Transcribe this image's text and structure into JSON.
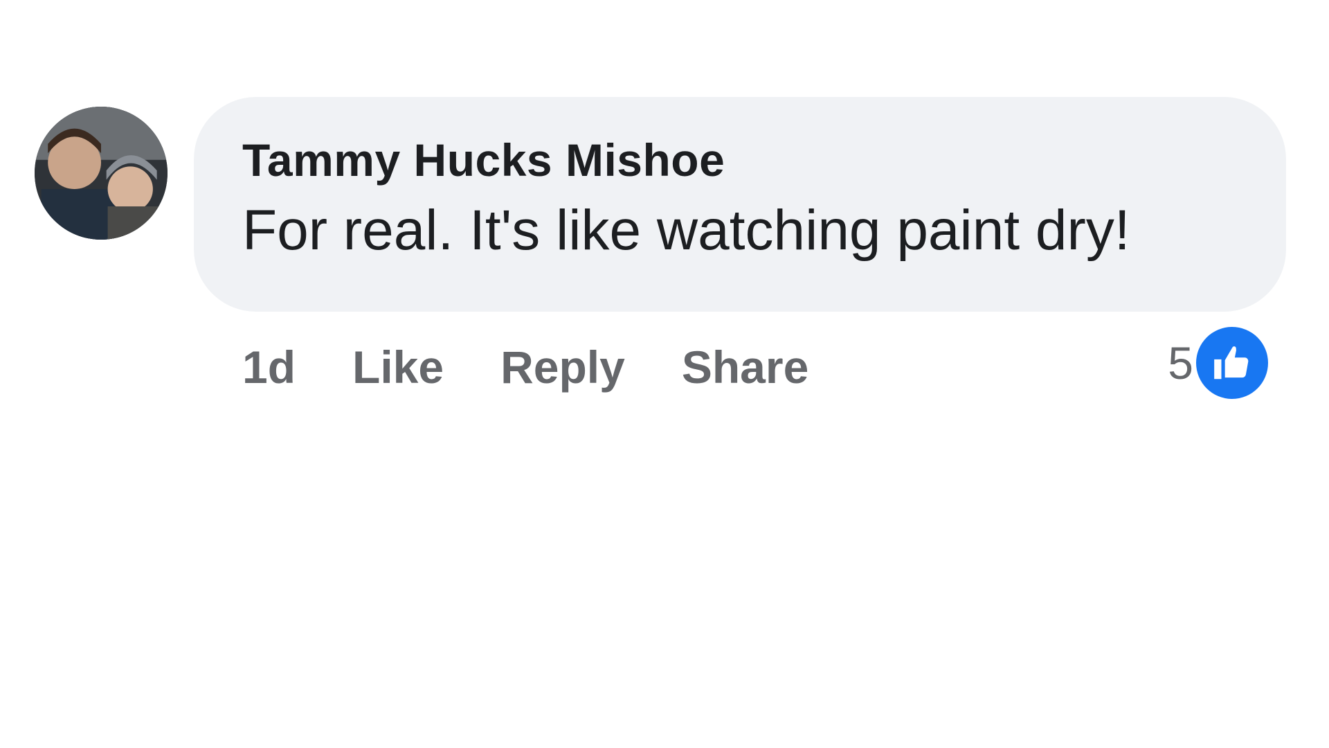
{
  "comment": {
    "author": "Tammy Hucks Mishoe",
    "text": "For real. It's like watching paint dry!",
    "timestamp": "1d",
    "actions": {
      "like_label": "Like",
      "reply_label": "Reply",
      "share_label": "Share"
    },
    "reactions": {
      "count": "5",
      "icon": "thumbs-up-icon",
      "color": "#1877f2"
    }
  }
}
